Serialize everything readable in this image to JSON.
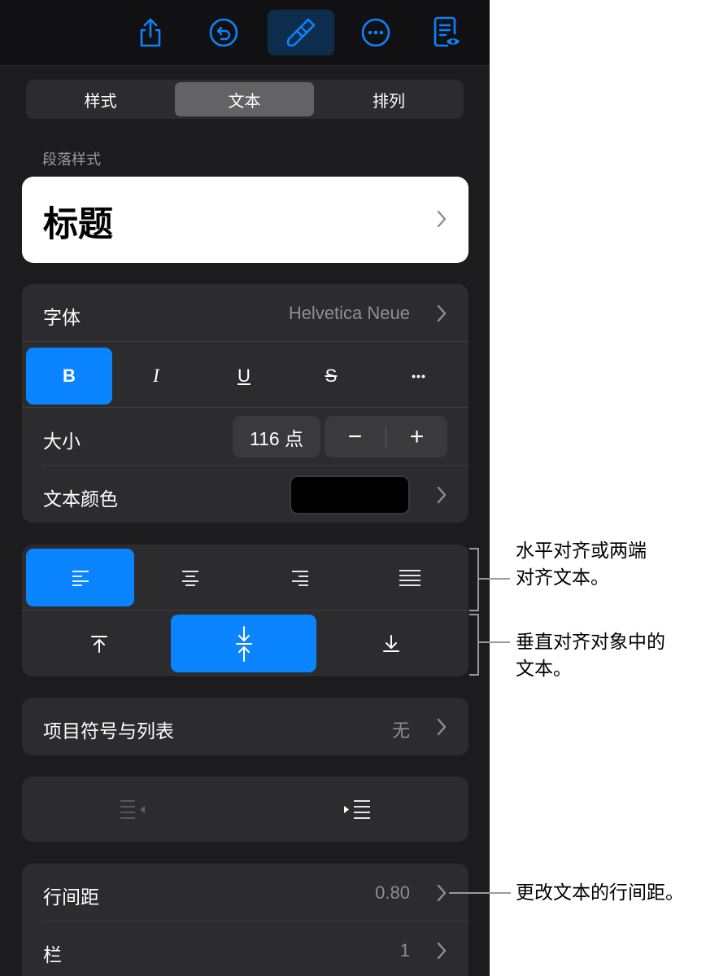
{
  "toolbar": {
    "icons": [
      "share-icon",
      "undo-icon",
      "format-brush-icon",
      "more-icon",
      "reading-view-icon"
    ],
    "active_icon": "format-brush-icon",
    "accent": "#0a84ff"
  },
  "tabs": [
    {
      "label": "样式",
      "selected": false
    },
    {
      "label": "文本",
      "selected": true
    },
    {
      "label": "排列",
      "selected": false
    }
  ],
  "paragraph_style": {
    "section_label": "段落样式",
    "current": "标题"
  },
  "font": {
    "label": "字体",
    "value": "Helvetica Neue",
    "format_buttons": [
      {
        "label": "B",
        "name": "bold",
        "active": true
      },
      {
        "label": "I",
        "name": "italic",
        "active": false
      },
      {
        "label": "U",
        "name": "underline",
        "active": false
      },
      {
        "label": "S",
        "name": "strikethrough",
        "active": false
      },
      {
        "label": "•••",
        "name": "more-options",
        "active": false
      }
    ],
    "size_label": "大小",
    "size_value": "116 点",
    "minus": "−",
    "plus": "+",
    "color_label": "文本颜色",
    "color_value": "#000000"
  },
  "alignment": {
    "horizontal": [
      "left",
      "center",
      "right",
      "justify"
    ],
    "horizontal_selected": "left",
    "vertical": [
      "top",
      "middle",
      "bottom"
    ],
    "vertical_selected": "middle"
  },
  "bullets": {
    "label": "项目符号与列表",
    "value": "无"
  },
  "indent": {
    "decrease_enabled": false,
    "increase_enabled": true
  },
  "spacing": {
    "line_label": "行间距",
    "line_value": "0.80",
    "columns_label": "栏",
    "columns_value": "1"
  },
  "callouts": {
    "horizontal_line1": "水平对齐或两端",
    "horizontal_line2": "对齐文本。",
    "vertical_line1": "垂直对齐对象中的",
    "vertical_line2": "文本。",
    "line_spacing": "更改文本的行间距。"
  }
}
